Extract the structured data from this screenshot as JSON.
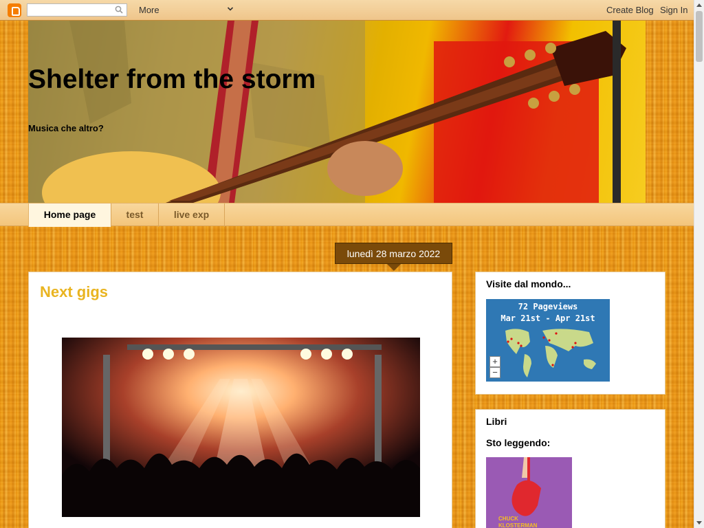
{
  "navbar": {
    "search_placeholder": "",
    "more_label": "More",
    "create_blog": "Create Blog",
    "sign_in": "Sign In"
  },
  "header": {
    "title": "Shelter from the storm",
    "description": "Musica che altro?"
  },
  "tabs": [
    {
      "label": "Home page",
      "active": true
    },
    {
      "label": "test",
      "active": false
    },
    {
      "label": "live exp",
      "active": false
    }
  ],
  "date_header": "lunedì 28 marzo 2022",
  "post": {
    "title": "Next gigs"
  },
  "sidebar": {
    "visits": {
      "title": "Visite dal mondo...",
      "pageviews": "72 Pageviews",
      "range": "Mar 21st - Apr 21st",
      "zoom_in": "+",
      "zoom_out": "−"
    },
    "books": {
      "title": "Libri",
      "subtitle": "Sto leggendo:",
      "cover_author": "CHUCK KLOSTERMAN"
    }
  },
  "colors": {
    "post_title": "#e9b420",
    "date_header_bg": "#7a4a0a",
    "map_bg": "#2f78b4"
  }
}
